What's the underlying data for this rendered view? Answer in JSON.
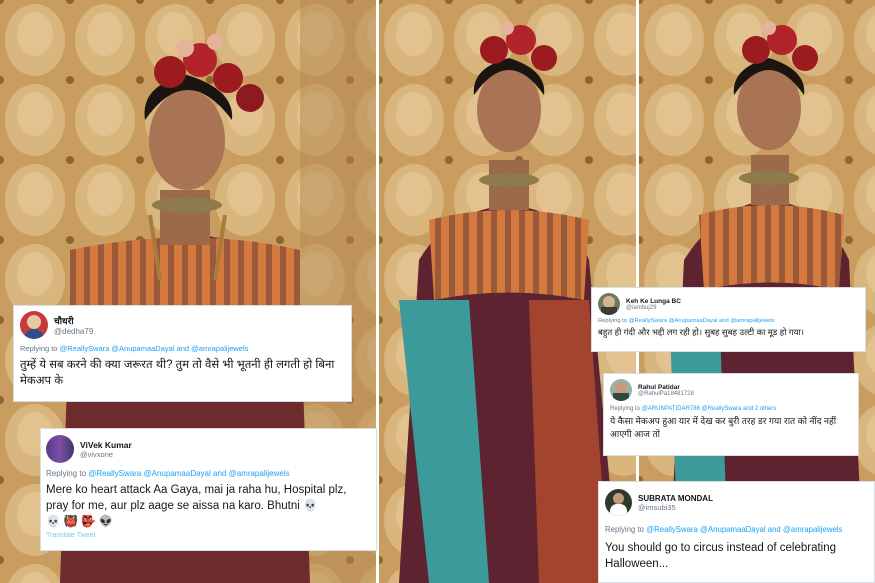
{
  "tweets": [
    {
      "name": "चौधरी",
      "handle": "@dedha79",
      "replying_prefix": "Replying to",
      "replying_to": "@ReallySwara @AnupamaaDayal and @amrapalijewels",
      "text": "तुम्हें ये सब करने की क्या जरूरत थी? तुम तो वैसे भी भूतनी ही लगती  हो बिना मेकअप के"
    },
    {
      "name": "ViVek Kumar",
      "handle": "@vivxone",
      "replying_prefix": "Replying to",
      "replying_to": "@ReallySwara @AnupamaaDayal and @amrapalijewels",
      "text": "Mere ko heart attack Aa Gaya, mai ja raha hu, Hospital plz, pray for me, aur plz aage se aissa na karo. Bhutni",
      "emojis": "💀 👹 👺 👽",
      "footer": "Translate Tweet"
    },
    {
      "name": "Keh Ke Lunga BC",
      "handle": "@iambuj29",
      "replying_prefix": "Replying to",
      "replying_to": "@ReallySwara @AnupamaaDayal and @amrapalijewels",
      "text": "बहुत ही गंदी और भद्दी लग रही हो। सुबह सुबह उल्टी का मूड हो गया।"
    },
    {
      "name": "Rahul Patidar",
      "handle": "@RahulPa18481728",
      "replying_prefix": "Replying to",
      "replying_to": "@ARUNPATIDAR786 @ReallySwara and 2 others",
      "text": "ये कैसा मेकअप हुआ यार में देख कर बुरी तरह डर गया रात को नींद नहीं आएगी आज तो"
    },
    {
      "name": "SUBRATA MONDAL",
      "handle": "@imsubi35",
      "replying_prefix": "Replying to",
      "replying_to": "@ReallySwara @AnupamaaDayal and @amrapalijewels",
      "text": "You should go to circus instead of celebrating Halloween..."
    }
  ],
  "icons": {
    "skull_emoji": "💀",
    "colors": {
      "link": "#1da1f2",
      "muted": "#657786",
      "text": "#14171a"
    }
  }
}
